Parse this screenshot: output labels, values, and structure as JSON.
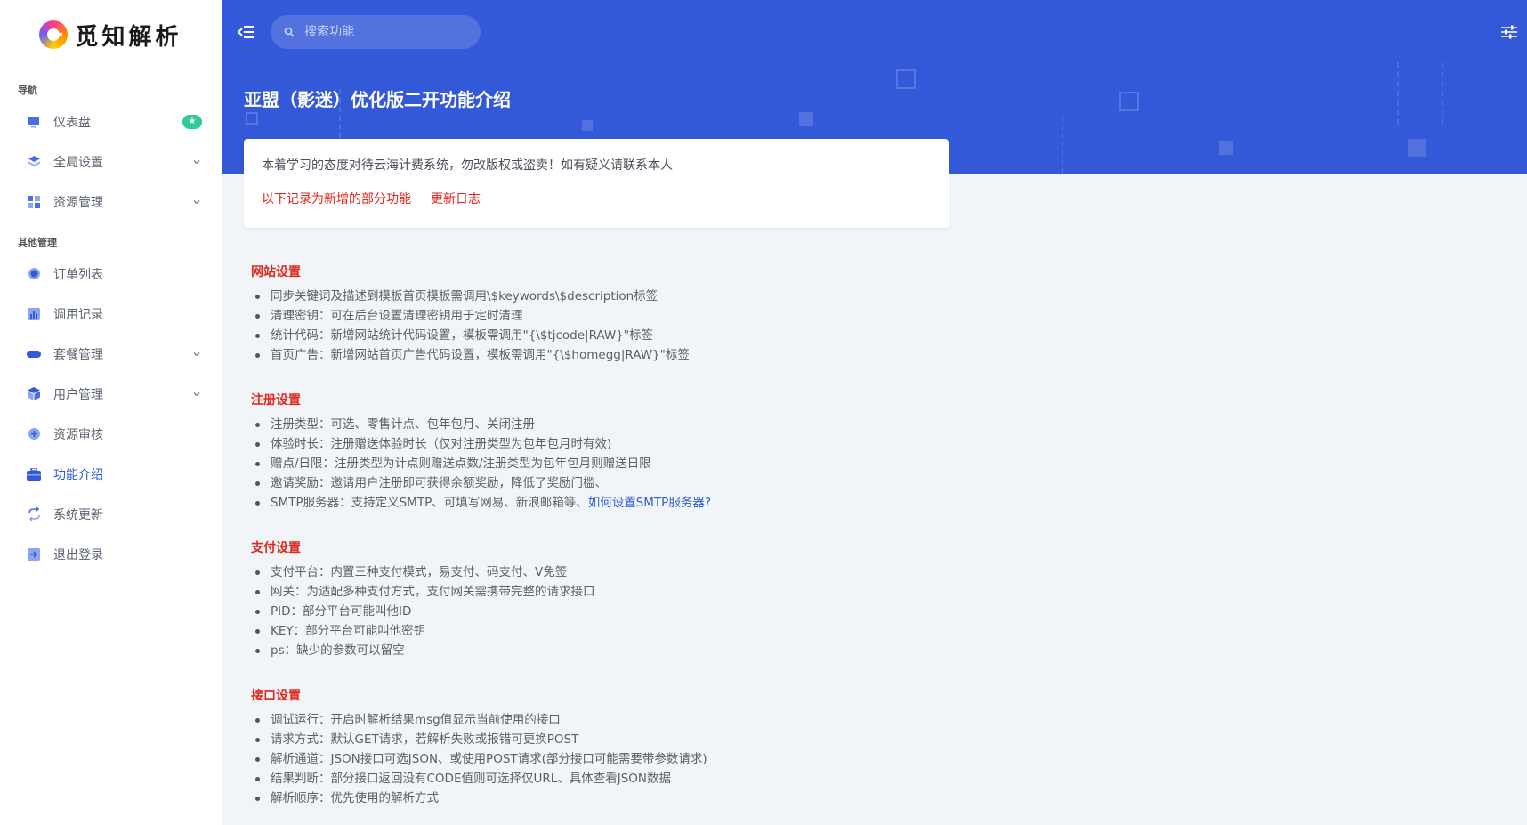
{
  "brand": {
    "name": "觅知解析"
  },
  "sidebar": {
    "sections": [
      {
        "title": "导航"
      },
      {
        "title": "其他管理"
      }
    ],
    "nav_top": [
      {
        "label": "仪表盘",
        "icon": "dashboard-icon",
        "badge": "★"
      },
      {
        "label": "全局设置",
        "icon": "layers-icon"
      },
      {
        "label": "资源管理",
        "icon": "grid-icon"
      }
    ],
    "nav_other": [
      {
        "label": "订单列表",
        "icon": "circle-icon"
      },
      {
        "label": "调用记录",
        "icon": "bar-chart-icon"
      },
      {
        "label": "套餐管理",
        "icon": "pill-icon"
      },
      {
        "label": "用户管理",
        "icon": "cube-icon"
      },
      {
        "label": "资源审核",
        "icon": "plus-circle-icon"
      },
      {
        "label": "功能介绍",
        "icon": "briefcase-icon",
        "active": true
      },
      {
        "label": "系统更新",
        "icon": "refresh-icon"
      },
      {
        "label": "退出登录",
        "icon": "logout-icon"
      }
    ]
  },
  "header": {
    "search_placeholder": "搜索功能",
    "title": "亚盟（影迷）优化版二开功能介绍"
  },
  "notice": {
    "text": "本着学习的态度对待云海计费系统，勿改版权或盗卖！如有疑义请联系本人",
    "link1": "以下记录为新增的部分功能",
    "link2": "更新日志"
  },
  "sections": [
    {
      "title": "网站设置",
      "items": [
        "同步关键词及描述到模板首页模板需调用\\$keywords\\$description标签",
        "清理密钥：可在后台设置清理密钥用于定时清理",
        "统计代码：新增网站统计代码设置，模板需调用\"{\\$tjcode|RAW}\"标签",
        "首页广告：新增网站首页广告代码设置，模板需调用\"{\\$homegg|RAW}\"标签"
      ]
    },
    {
      "title": "注册设置",
      "items": [
        "注册类型：可选、零售计点、包年包月、关闭注册",
        "体验时长：注册赠送体验时长（仅对注册类型为包年包月时有效)",
        "赠点/日限：注册类型为计点则赠送点数/注册类型为包年包月则赠送日限",
        "邀请奖励：邀请用户注册即可获得余额奖励，降低了奖励门槛、",
        "SMTP服务器：支持定义SMTP、可填写网易、新浪邮箱等、"
      ],
      "link": "如何设置SMTP服务器?"
    },
    {
      "title": "支付设置",
      "items": [
        "支付平台：内置三种支付模式，易支付、码支付、V免签",
        "网关：为适配多种支付方式，支付网关需携带完整的请求接口",
        "PID：部分平台可能叫他ID",
        "KEY：部分平台可能叫他密钥",
        "ps：缺少的参数可以留空"
      ]
    },
    {
      "title": "接口设置",
      "items": [
        "调试运行：开启时解析结果msg值显示当前使用的接口",
        "请求方式：默认GET请求，若解析失败或报错可更换POST",
        "解析通道：JSON接口可选JSON、或使用POST请求(部分接口可能需要带参数请求)",
        "结果判断：部分接口返回没有CODE值则可选择仅URL、具体查看JSON数据",
        "解析顺序：优先使用的解析方式"
      ]
    }
  ],
  "colors": {
    "primary": "#3358d8",
    "accent_red": "#e0261f",
    "badge_green": "#2ecc9a"
  }
}
